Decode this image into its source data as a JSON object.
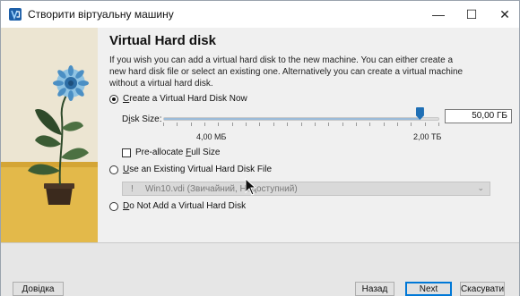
{
  "window": {
    "title": "Створити віртуальну машину",
    "controls": {
      "minimize": "—",
      "maximize": "☐",
      "close": "✕"
    }
  },
  "page": {
    "heading": "Virtual Hard disk",
    "description": "If you wish you can add a virtual hard disk to the new machine. You can either create a new hard disk file or select an existing one. Alternatively you can create a virtual machine without a virtual hard disk."
  },
  "options": {
    "create_new": {
      "label": "Create a Virtual Hard Disk Now",
      "mnemonic": "C",
      "rest": "reate a Virtual Hard Disk Now",
      "checked": true
    },
    "use_existing": {
      "label": "Use an Existing Virtual Hard Disk File",
      "mnemonic": "U",
      "rest": "se an Existing Virtual Hard Disk File",
      "checked": false
    },
    "no_disk": {
      "label": "Do Not Add a Virtual Hard Disk",
      "mnemonic": "D",
      "rest": "o Not Add a Virtual Hard Disk",
      "checked": false
    }
  },
  "disk_size": {
    "label": "Disk Size:",
    "label_prefix": "D",
    "label_mnemonic": "i",
    "label_rest": "sk Size:",
    "value": "50,00 ГБ",
    "slider_fraction": 0.93,
    "min_label": "4,00 МБ",
    "max_label": "2,00 ТБ"
  },
  "preallocate": {
    "label": "Pre-allocate Full Size",
    "prefix": "Pre-allocate ",
    "mnemonic": "F",
    "rest": "ull Size",
    "checked": false
  },
  "existing_disk_combo": {
    "value": "Win10.vdi (Звичайний, Недоступний)",
    "enabled": false
  },
  "footer": {
    "help": "Довідка",
    "back": "Назад",
    "next": "Next",
    "cancel": "Скасувати"
  },
  "colors": {
    "accent": "#0078d7",
    "slider_thumb": "#1f6fb5",
    "illustration_bg": "#e9e1cc"
  }
}
